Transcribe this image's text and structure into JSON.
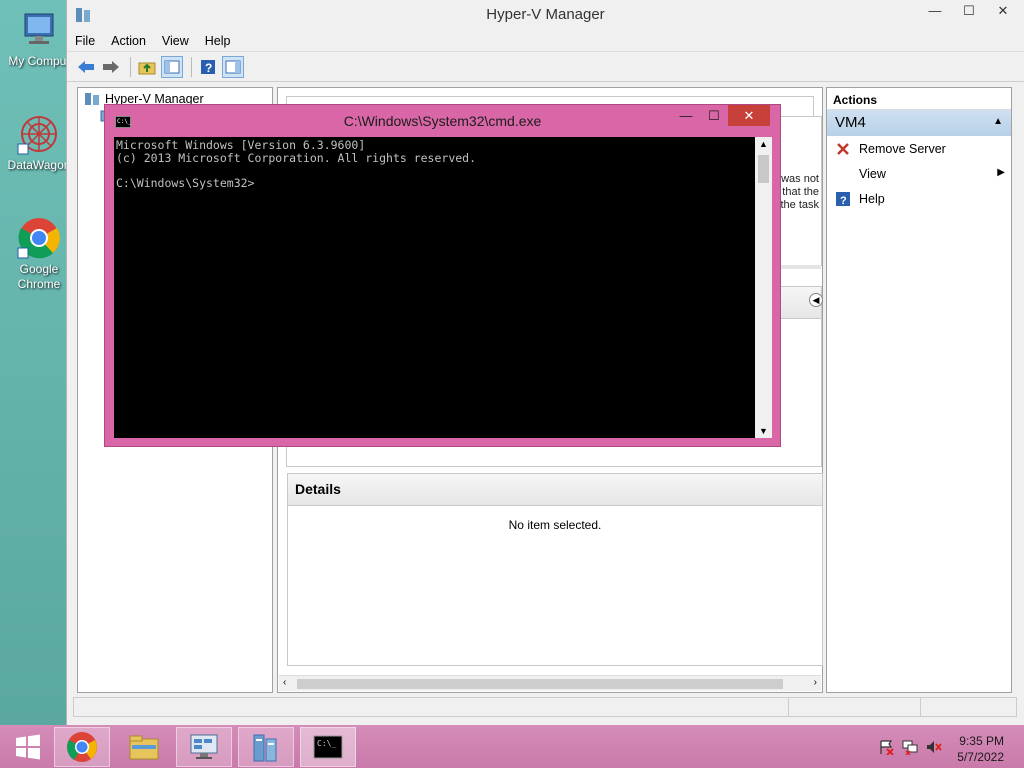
{
  "desktop": {
    "icons": [
      {
        "label": "My Comput"
      },
      {
        "label": "DataWagon"
      },
      {
        "label": "Google Chrome"
      }
    ]
  },
  "hyperv": {
    "title": "Hyper-V Manager",
    "window_controls": {
      "minimize": "—",
      "maximize": "☐",
      "close": "✕"
    },
    "menu": [
      "File",
      "Action",
      "View",
      "Help"
    ],
    "tree_root": "Hyper-V Manager",
    "center_fragments": [
      "was not",
      "y that the",
      "the task"
    ],
    "details": {
      "title": "Details",
      "empty_text": "No item selected."
    },
    "actions": {
      "header": "Actions",
      "section": "VM4",
      "items": [
        {
          "label": "Remove Server",
          "icon": "remove-server-icon"
        },
        {
          "label": "View",
          "icon": "none"
        },
        {
          "label": "Help",
          "icon": "help-icon"
        }
      ]
    }
  },
  "cmd": {
    "title": "C:\\Windows\\System32\\cmd.exe",
    "icon_text": "C:\\_",
    "lines": "Microsoft Windows [Version 6.3.9600]\n(c) 2013 Microsoft Corporation. All rights reserved.\n\nC:\\Windows\\System32>",
    "controls": {
      "minimize": "—",
      "maximize": "☐",
      "close": "✕"
    }
  },
  "taskbar": {
    "clock_time": "9:35 PM",
    "clock_date": "5/7/2022",
    "apps": [
      "Start",
      "Google Chrome",
      "File Explorer",
      "Server Manager",
      "Hyper-V Manager",
      "Command Prompt"
    ]
  },
  "colors": {
    "taskbar": "#d083b2",
    "cmd_frame": "#d966a6",
    "cmd_close": "#c7403a",
    "desktop": "#67b8b0",
    "actions_section": "#c2d7ec"
  }
}
